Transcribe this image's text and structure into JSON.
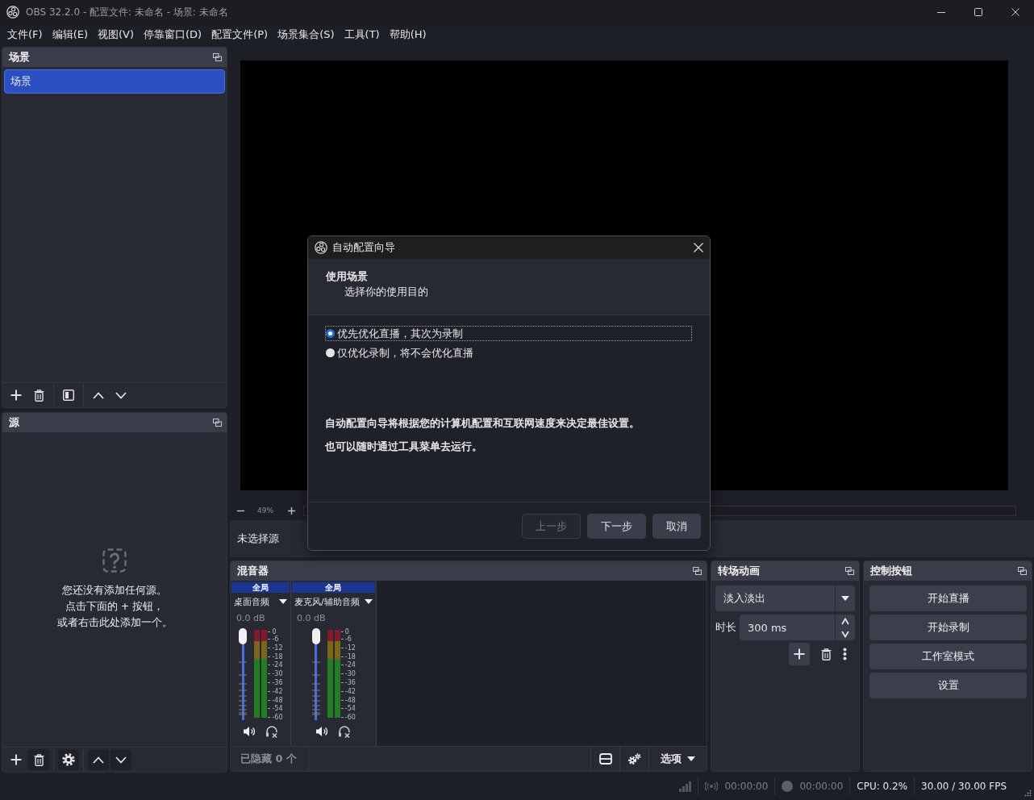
{
  "window": {
    "title": "OBS 32.2.0 - 配置文件: 未命名 - 场景: 未命名"
  },
  "menu": [
    "文件(F)",
    "编辑(E)",
    "视图(V)",
    "停靠窗口(D)",
    "配置文件(P)",
    "场景集合(S)",
    "工具(T)",
    "帮助(H)"
  ],
  "scenes": {
    "title": "场景",
    "items": [
      {
        "label": "场景",
        "selected": true
      }
    ]
  },
  "sources": {
    "title": "源",
    "empty_message": [
      "您还没有添加任何源。",
      "点击下面的 + 按钮，",
      "或者右击此处添加一个。"
    ]
  },
  "preview": {
    "zoom": "49%"
  },
  "context_bar": {
    "label": "未选择源"
  },
  "mixer": {
    "title": "混音器",
    "channels": [
      {
        "scope": "全局",
        "name": "桌面音频",
        "volume": "0.0 dB",
        "level": 1,
        "scale": [
          "0",
          "-6",
          "-12",
          "-18",
          "-24",
          "-30",
          "-36",
          "-42",
          "-48",
          "-54",
          "-60"
        ]
      },
      {
        "scope": "全局",
        "name": "麦克风/辅助音频",
        "volume": "0.0 dB",
        "level": 1,
        "scale": [
          "0",
          "-6",
          "-12",
          "-18",
          "-24",
          "-30",
          "-36",
          "-42",
          "-48",
          "-54",
          "-60"
        ]
      }
    ],
    "hidden_count": "已隐藏 0 个",
    "options": "选项"
  },
  "transitions": {
    "title": "转场动画",
    "transition": "淡入淡出",
    "duration_label": "时长",
    "duration": "300 ms"
  },
  "controls": {
    "title": "控制按钮",
    "buttons": [
      "开始直播",
      "开始录制",
      "工作室模式",
      "设置"
    ]
  },
  "status_bar": {
    "stream_time": "00:00:00",
    "record_time": "00:00:00",
    "cpu": "CPU: 0.2%",
    "fps": "30.00 / 30.00 FPS"
  },
  "dialog": {
    "title": "自动配置向导",
    "heading": "使用场景",
    "subheading": "选择你的使用目的",
    "options": [
      {
        "label": "优先优化直播，其次为录制",
        "selected": true
      },
      {
        "label": "仅优化录制，将不会优化直播",
        "selected": false
      }
    ],
    "info": [
      "自动配置向导将根据您的计算机配置和互联网速度来决定最佳设置。",
      "也可以随时通过工具菜单去运行。"
    ],
    "buttons": [
      {
        "label": "上一步",
        "disabled": true
      },
      {
        "label": "下一步",
        "disabled": false
      },
      {
        "label": "取消",
        "disabled": false
      }
    ]
  }
}
